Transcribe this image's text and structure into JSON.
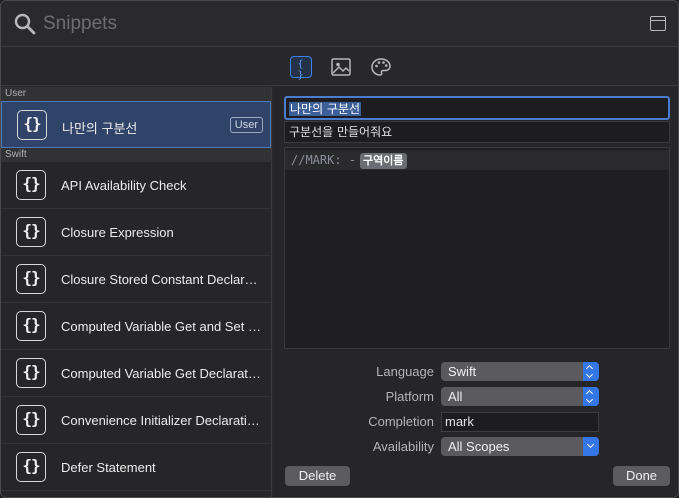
{
  "search": {
    "placeholder": "Snippets"
  },
  "segments": {
    "code_glyph": "{ }"
  },
  "list": {
    "sections": [
      {
        "header": "User"
      },
      {
        "header": "Swift"
      }
    ],
    "user_items": [
      {
        "title": "나만의 구분선",
        "badge": "User",
        "icon_glyph": "{}"
      }
    ],
    "swift_items": [
      {
        "title": "API Availability Check",
        "icon_glyph": "{}"
      },
      {
        "title": "Closure Expression",
        "icon_glyph": "{}"
      },
      {
        "title": "Closure Stored Constant Declaration",
        "icon_glyph": "{}"
      },
      {
        "title": "Computed Variable Get and Set Declaration",
        "icon_glyph": "{}"
      },
      {
        "title": "Computed Variable Get Declaration",
        "icon_glyph": "{}"
      },
      {
        "title": "Convenience Initializer Declaration",
        "icon_glyph": "{}"
      },
      {
        "title": "Defer Statement",
        "icon_glyph": "{}"
      }
    ]
  },
  "detail": {
    "title": "나만의 구분선",
    "summary": "구분선을 만들어줘요",
    "code": {
      "prefix": "//MARK: -",
      "token": "구역이름"
    },
    "properties": {
      "language_label": "Language",
      "language_value": "Swift",
      "platform_label": "Platform",
      "platform_value": "All",
      "completion_label": "Completion",
      "completion_value": "mark",
      "availability_label": "Availability",
      "availability_value": "All Scopes"
    },
    "buttons": {
      "delete": "Delete",
      "done": "Done"
    }
  },
  "colors": {
    "accent": "#3476e6",
    "selection": "#2f4468",
    "background": "#28282a"
  }
}
